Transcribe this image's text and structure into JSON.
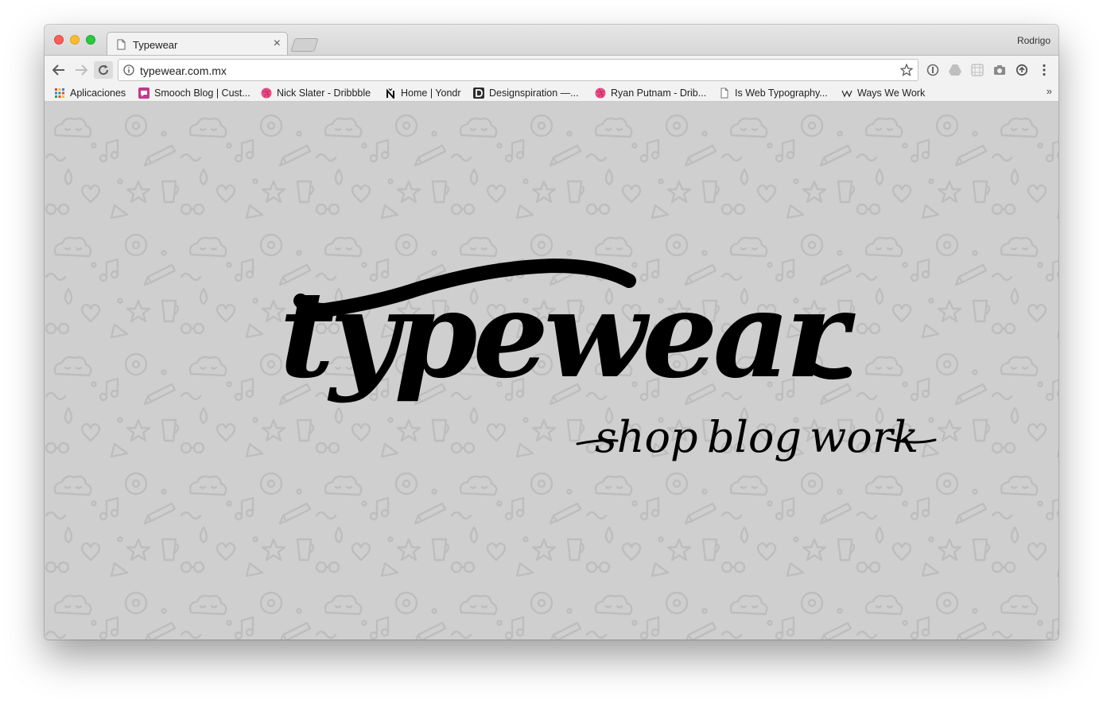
{
  "browser": {
    "tab_title": "Typewear",
    "tab_close_glyph": "×",
    "profile_name": "Rodrigo",
    "url": "typewear.com.mx",
    "bookmarks_overflow": "»",
    "bookmarks": [
      {
        "label": "Aplicaciones",
        "icon": "apps-grid-icon"
      },
      {
        "label": "Smooch Blog | Cust...",
        "icon": "smooch-icon"
      },
      {
        "label": "Nick Slater - Dribbble",
        "icon": "dribbble-icon"
      },
      {
        "label": "Home | Yondr",
        "icon": "yondr-icon"
      },
      {
        "label": "Designspiration —...",
        "icon": "designspiration-icon"
      },
      {
        "label": "Ryan Putnam - Drib...",
        "icon": "dribbble-icon"
      },
      {
        "label": "Is Web Typography...",
        "icon": "page-icon"
      },
      {
        "label": "Ways We Work",
        "icon": "waysweework-icon"
      }
    ],
    "extensions": [
      "1password-icon",
      "drive-icon",
      "grid-extension-icon",
      "camera-icon",
      "sync-icon",
      "menu-dots-icon"
    ],
    "colors": {
      "traffic_red": "#fc5f57",
      "traffic_yellow": "#fdbc2e",
      "traffic_green": "#28c840",
      "dribbble": "#ea4c89",
      "smooch": "#c03b8c"
    }
  },
  "page": {
    "logo": "typewear",
    "nav": [
      "shop",
      "blog",
      "work"
    ],
    "background_color": "#cfcfcf",
    "pattern_color": "#bebebe"
  }
}
